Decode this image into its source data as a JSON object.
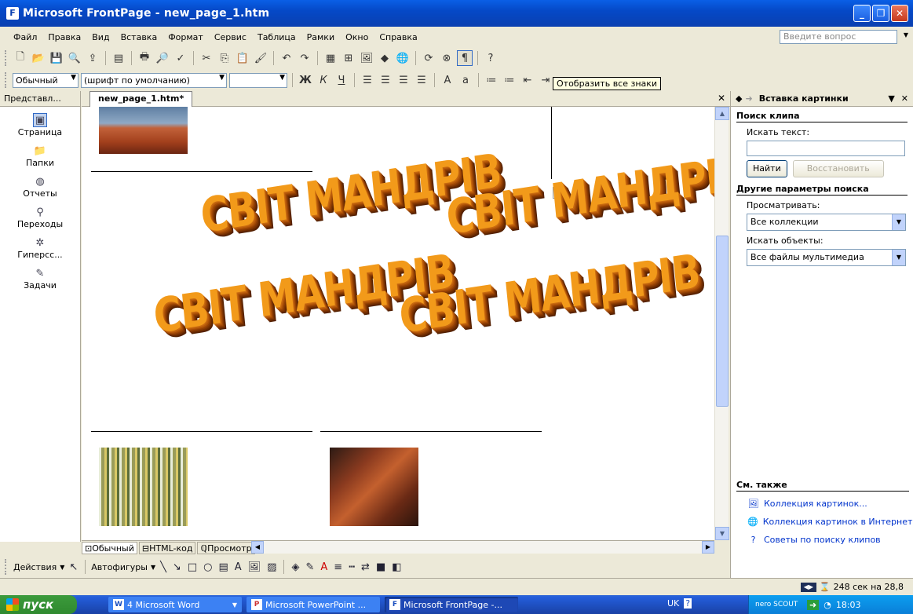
{
  "window": {
    "title": "Microsoft FrontPage - new_page_1.htm"
  },
  "menu": [
    "Файл",
    "Правка",
    "Вид",
    "Вставка",
    "Формат",
    "Сервис",
    "Таблица",
    "Рамки",
    "Окно",
    "Справка"
  ],
  "ask_placeholder": "Введите вопрос",
  "format": {
    "style": "Обычный",
    "font": "(шрифт по умолчанию)",
    "tooltip": "Отобразить все знаки"
  },
  "views": {
    "header": "Представл...",
    "items": [
      "Страница",
      "Папки",
      "Отчеты",
      "Переходы",
      "Гиперсс...",
      "Задачи"
    ]
  },
  "editor": {
    "tab": "new_page_1.htm*",
    "wordart": [
      "СВІТ МАНДРІВ",
      "СВІТ МАНДРІВ",
      "СВІТ МАНДРІВ",
      "СВІТ МАНДРІВ"
    ],
    "view_tabs": [
      "Обычный",
      "HTML-код",
      "Просмотр"
    ]
  },
  "taskpane": {
    "title": "Вставка картинки",
    "search_section": "Поиск клипа",
    "search_label": "Искать текст:",
    "search_value": "",
    "find_button": "Найти",
    "restore_button": "Восстановить",
    "other_section": "Другие параметры поиска",
    "browse_label": "Просматривать:",
    "browse_value": "Все коллекции",
    "objects_label": "Искать объекты:",
    "objects_value": "Все файлы мультимедиа",
    "see_also": "См. также",
    "links": [
      "Коллекция картинок...",
      "Коллекция картинок в Интернет",
      "Советы по поиску клипов"
    ]
  },
  "drawing": {
    "actions": "Действия",
    "autoshapes": "Автофигуры"
  },
  "status": {
    "download": "248 сек на 28,8"
  },
  "taskbar": {
    "start": "пуск",
    "tasks": [
      "4 Microsoft Word",
      "Microsoft PowerPoint ...",
      "Microsoft FrontPage -..."
    ],
    "lang": "UK",
    "nero": "nero SCOUT",
    "time": "18:03"
  }
}
